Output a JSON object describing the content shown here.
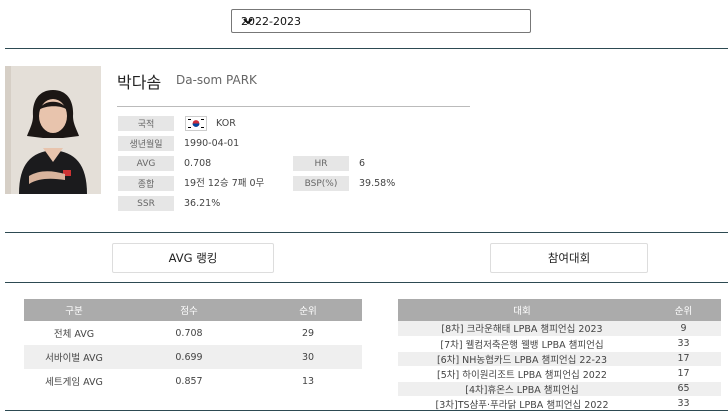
{
  "season": {
    "selected": "2022-2023"
  },
  "player": {
    "name_ko": "박다솜",
    "name_en": "Da-som PARK",
    "fields": {
      "nationality_label": "국적",
      "nationality": "KOR",
      "birth_label": "생년월일",
      "birth": "1990-04-01",
      "avg_label": "AVG",
      "avg": "0.708",
      "hr_label": "HR",
      "hr": "6",
      "record_label": "종합",
      "record": "19전 12승 7패 0무",
      "bsp_label": "BSP(%)",
      "bsp": "39.58%",
      "ssr_label": "SSR",
      "ssr": "36.21%"
    }
  },
  "buttons": {
    "avg_ranking": "AVG 랭킹",
    "tournaments": "참여대회"
  },
  "ranking_table": {
    "headers": [
      "구분",
      "점수",
      "순위"
    ],
    "rows": [
      [
        "전체 AVG",
        "0.708",
        "29"
      ],
      [
        "서바이벌 AVG",
        "0.699",
        "30"
      ],
      [
        "세트게임 AVG",
        "0.857",
        "13"
      ]
    ]
  },
  "tournament_table": {
    "headers": [
      "대회",
      "순위"
    ],
    "rows": [
      [
        "[8차] 크라운해태 LPBA 챔피언십 2023",
        "9"
      ],
      [
        "[7차] 웰컴저축은행 웰뱅 LPBA 챔피언십",
        "33"
      ],
      [
        "[6차] NH농협카드 LPBA 챔피언십 22-23",
        "17"
      ],
      [
        "[5차] 하이원리조트 LPBA 챔피언십 2022",
        "17"
      ],
      [
        "[4차]휴온스 LPBA 챔피언십",
        "65"
      ],
      [
        "[3차]TS샴푸·푸라닭 LPBA 챔피언십 2022",
        "33"
      ]
    ]
  },
  "colors": {
    "rule": "#2d4a52",
    "header_bg": "#ababab",
    "label_bg": "#e6e6e6"
  }
}
